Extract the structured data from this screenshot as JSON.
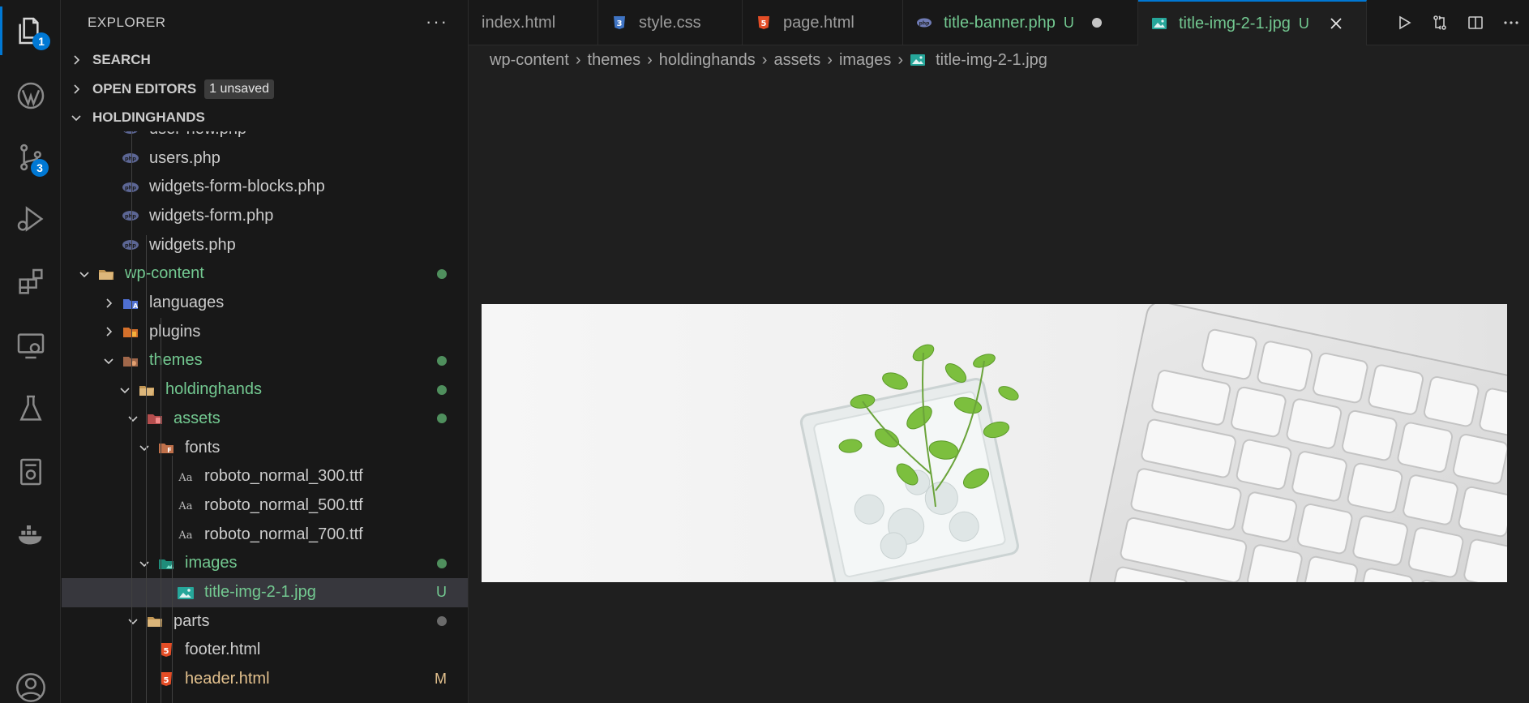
{
  "activity_bar": {
    "explorer_badge": "1",
    "scm_badge": "3",
    "items": [
      "files-icon",
      "wordpress-icon",
      "source-control-icon",
      "run-debug-icon",
      "extensions-icon",
      "remote-explorer-icon",
      "testing-icon",
      "docker-icon",
      "account-icon"
    ]
  },
  "sidebar": {
    "title": "EXPLORER",
    "more": "···",
    "sections": {
      "search": "SEARCH",
      "open_editors": "OPEN EDITORS",
      "open_editors_badge": "1 unsaved",
      "workspace": "HOLDINGHANDS"
    },
    "tree": [
      {
        "label": "user-new.php",
        "icon": "php-icon",
        "depth": 2,
        "partial": true
      },
      {
        "label": "users.php",
        "icon": "php-icon",
        "depth": 2
      },
      {
        "label": "widgets-form-blocks.php",
        "icon": "php-icon",
        "depth": 2
      },
      {
        "label": "widgets-form.php",
        "icon": "php-icon",
        "depth": 2
      },
      {
        "label": "widgets.php",
        "icon": "php-icon",
        "depth": 2
      },
      {
        "label": "wp-content",
        "icon": "folder-open-icon",
        "depth": 1,
        "twisty": "open",
        "state": "green",
        "dot": true
      },
      {
        "label": "languages",
        "icon": "folder-i18n-icon",
        "depth": 2,
        "twisty": "closed"
      },
      {
        "label": "plugins",
        "icon": "folder-plugin-icon",
        "depth": 2,
        "twisty": "closed"
      },
      {
        "label": "themes",
        "icon": "folder-theme-icon",
        "depth": 2,
        "twisty": "open",
        "state": "green",
        "dot": true
      },
      {
        "label": "holdinghands",
        "icon": "folder-open-icon",
        "depth": 3,
        "twisty": "open",
        "state": "green",
        "dot": true
      },
      {
        "label": "assets",
        "icon": "folder-assets-icon",
        "depth": 4,
        "twisty": "open",
        "state": "green",
        "dot": true
      },
      {
        "label": "fonts",
        "icon": "folder-fonts-icon",
        "depth": 5,
        "twisty": "open"
      },
      {
        "label": "roboto_normal_300.ttf",
        "icon": "font-icon",
        "depth": 6
      },
      {
        "label": "roboto_normal_500.ttf",
        "icon": "font-icon",
        "depth": 6
      },
      {
        "label": "roboto_normal_700.ttf",
        "icon": "font-icon",
        "depth": 6
      },
      {
        "label": "images",
        "icon": "folder-images-icon",
        "depth": 5,
        "twisty": "open",
        "state": "green",
        "dot": true
      },
      {
        "label": "title-img-2-1.jpg",
        "icon": "image-file-icon",
        "depth": 6,
        "state": "green",
        "status": "U",
        "selected": true
      },
      {
        "label": "parts",
        "icon": "folder-open-icon",
        "depth": 4,
        "twisty": "open",
        "dot_grey": true
      },
      {
        "label": "footer.html",
        "icon": "html-icon",
        "depth": 5
      },
      {
        "label": "header.html",
        "icon": "html-icon",
        "depth": 5,
        "state": "mod",
        "status": "M"
      }
    ]
  },
  "tabs": [
    {
      "label": "index.html",
      "icon": "html-icon-none",
      "status": ""
    },
    {
      "label": "style.css",
      "icon": "css-icon",
      "status": ""
    },
    {
      "label": "page.html",
      "icon": "html-icon",
      "status": ""
    },
    {
      "label": "title-banner.php",
      "icon": "php-icon",
      "status": "U",
      "unsaved": true
    },
    {
      "label": "title-img-2-1.jpg",
      "icon": "image-file-icon",
      "status": "U",
      "active": true
    }
  ],
  "tab_actions": [
    "run-icon",
    "compare-changes-icon",
    "split-editor-icon",
    "more-actions-icon"
  ],
  "breadcrumb": [
    "wp-content",
    "themes",
    "holdinghands",
    "assets",
    "images",
    "title-img-2-1.jpg"
  ],
  "colors": {
    "accent": "#0078d4",
    "untracked": "#73c991",
    "modified": "#e2c08d"
  }
}
